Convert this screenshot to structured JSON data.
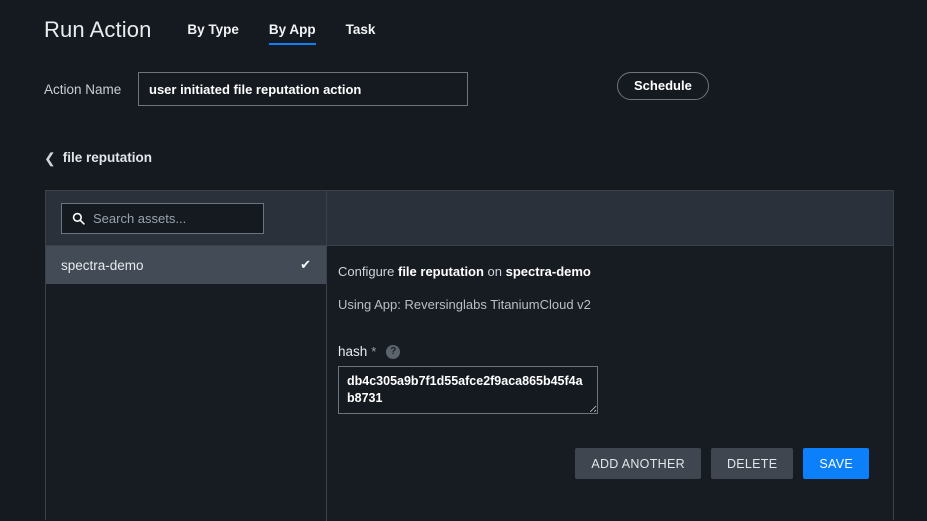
{
  "header": {
    "title": "Run Action",
    "tabs": [
      {
        "label": "By Type",
        "active": false
      },
      {
        "label": "By App",
        "active": true
      },
      {
        "label": "Task",
        "active": false
      }
    ]
  },
  "action_name": {
    "label": "Action Name",
    "value": "user initiated file reputation action",
    "placeholder": ""
  },
  "schedule": {
    "label": "Schedule"
  },
  "breadcrumb": {
    "back_icon": "chevron-left-icon",
    "label": "file reputation"
  },
  "panel": {
    "search": {
      "icon": "search-icon",
      "placeholder": "Search assets...",
      "value": ""
    },
    "assets": [
      {
        "name": "spectra-demo",
        "selected": true,
        "check_icon": "check-icon"
      }
    ],
    "config": {
      "title_prefix": "Configure ",
      "title_action": "file reputation",
      "title_middle": " on ",
      "title_asset": "spectra-demo",
      "using_app": "Using App: Reversinglabs TitaniumCloud v2",
      "field": {
        "label": "hash",
        "required_marker": "*",
        "help_icon": "question-mark-icon",
        "help_glyph": "?",
        "value": "db4c305a9b7f1d55afce2f9aca865b45f4ab8731",
        "placeholder": ""
      },
      "buttons": {
        "add_another": "ADD ANOTHER",
        "delete": "DELETE",
        "save": "SAVE"
      }
    }
  },
  "colors": {
    "background": "#151a20",
    "panel_header": "#2a313a",
    "accent_blue": "#0c7ffb",
    "selected_row": "#434b56",
    "border": "#3a4149",
    "input_border": "#6c757d"
  }
}
